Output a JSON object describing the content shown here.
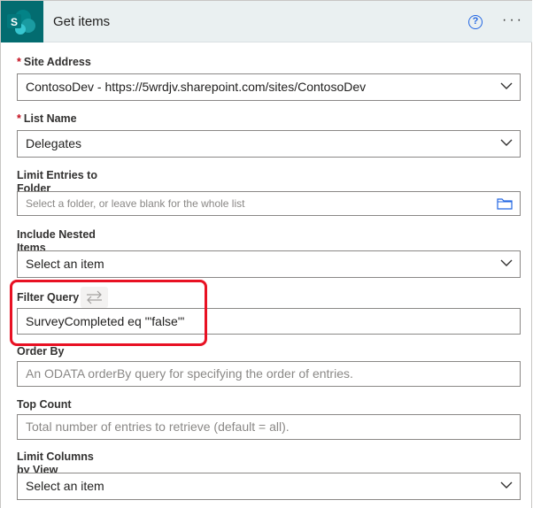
{
  "header": {
    "title": "Get items",
    "logo_letter": "S",
    "more_label": "···",
    "help_label": "?"
  },
  "fields": {
    "site_address": {
      "required_mark": "*",
      "label": "Site Address",
      "value": "ContosoDev - https://5wrdjv.sharepoint.com/sites/ContosoDev"
    },
    "list_name": {
      "required_mark": "*",
      "label": "List Name",
      "value": "Delegates"
    },
    "limit_entries": {
      "label": "Limit Entries to Folder",
      "placeholder": "Select a folder, or leave blank for the whole list"
    },
    "include_nested": {
      "label": "Include Nested Items",
      "value": "Select an item"
    },
    "filter_query": {
      "label": "Filter Query",
      "value": "SurveyCompleted eq '\"false\"'"
    },
    "order_by": {
      "label": "Order By",
      "placeholder": "An ODATA orderBy query for specifying the order of entries."
    },
    "top_count": {
      "label": "Top Count",
      "placeholder": "Total number of entries to retrieve (default = all)."
    },
    "limit_columns": {
      "label": "Limit Columns by View",
      "value": "Select an item"
    }
  },
  "colors": {
    "brand": "#036c70",
    "header_bg": "#eaf0f1",
    "required": "#c50f1f",
    "highlight": "#e81123",
    "help_accent": "#2266e3"
  }
}
